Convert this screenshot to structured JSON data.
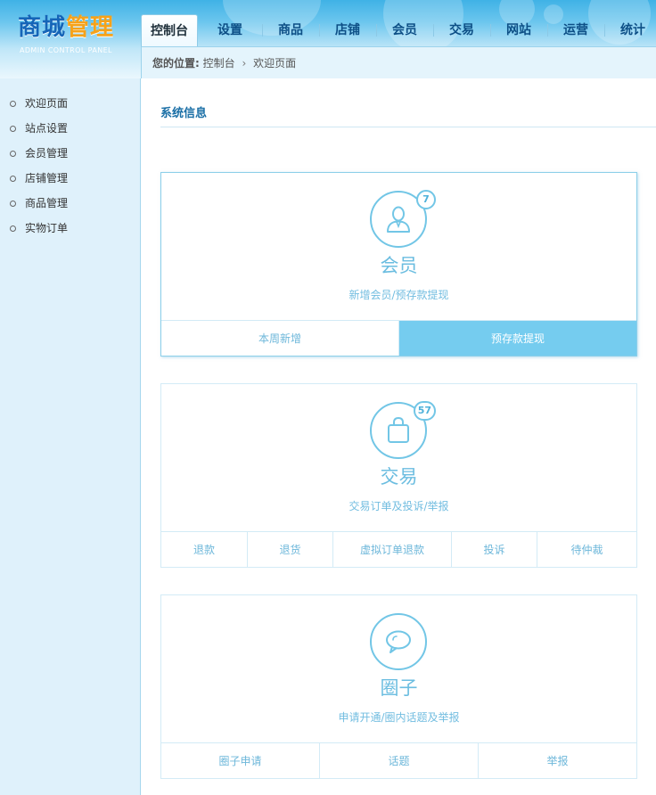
{
  "header": {
    "logo_part1": "商城",
    "logo_part2": "管理",
    "logo_sub": "ADMIN CONTROL PANEL"
  },
  "nav": {
    "items": [
      {
        "label": "控制台",
        "active": true
      },
      {
        "label": "设置"
      },
      {
        "label": "商品"
      },
      {
        "label": "店铺"
      },
      {
        "label": "会员"
      },
      {
        "label": "交易"
      },
      {
        "label": "网站"
      },
      {
        "label": "运营"
      },
      {
        "label": "统计"
      }
    ]
  },
  "breadcrumb": {
    "label": "您的位置:",
    "items": [
      "控制台",
      "欢迎页面"
    ],
    "separator": "›"
  },
  "sidebar": {
    "items": [
      {
        "label": "欢迎页面"
      },
      {
        "label": "站点设置"
      },
      {
        "label": "会员管理"
      },
      {
        "label": "店铺管理"
      },
      {
        "label": "商品管理"
      },
      {
        "label": "实物订单"
      }
    ]
  },
  "main": {
    "section_title": "系统信息",
    "cards": [
      {
        "icon": "user-icon",
        "badge": "7",
        "title": "会员",
        "desc": "新增会员/预存款提现",
        "actions": [
          "本周新增",
          "预存款提现"
        ],
        "active_action": 1
      },
      {
        "icon": "shopping-bag-icon",
        "badge": "57",
        "title": "交易",
        "desc": "交易订单及投诉/举报",
        "actions": [
          "退款",
          "退货",
          "虚拟订单退款",
          "投诉",
          "待仲裁"
        ]
      },
      {
        "icon": "chat-bubble-icon",
        "title": "圈子",
        "desc": "申请开通/圈内话题及举报",
        "actions": [
          "圈子申请",
          "话题",
          "举报"
        ]
      }
    ]
  },
  "colors": {
    "accent": "#75ccef",
    "nav_text": "#0d4f86",
    "logo_blue": "#1565b8",
    "logo_orange": "#f5a21a",
    "sidebar_bg": "#dff1fb"
  }
}
